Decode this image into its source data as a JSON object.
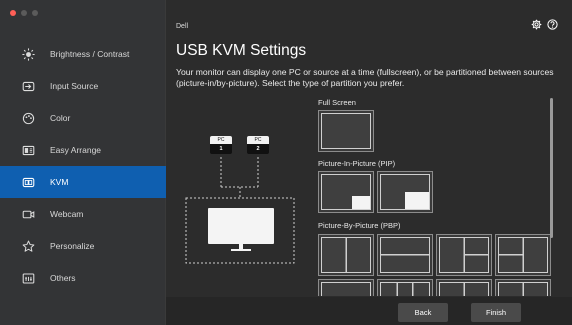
{
  "app": {
    "brand": "Dell"
  },
  "sidebar": {
    "items": [
      {
        "label": "Brightness / Contrast",
        "icon": "brightness-icon",
        "active": false
      },
      {
        "label": "Input Source",
        "icon": "input-source-icon",
        "active": false
      },
      {
        "label": "Color",
        "icon": "color-icon",
        "active": false
      },
      {
        "label": "Easy Arrange",
        "icon": "easy-arrange-icon",
        "active": false
      },
      {
        "label": "KVM",
        "icon": "kvm-icon",
        "active": true
      },
      {
        "label": "Webcam",
        "icon": "webcam-icon",
        "active": false
      },
      {
        "label": "Personalize",
        "icon": "star-icon",
        "active": false
      },
      {
        "label": "Others",
        "icon": "others-icon",
        "active": false
      }
    ]
  },
  "header": {
    "title": "USB KVM Settings",
    "description": "Your monitor can display one PC or source at a time (fullscreen), or be partitioned between sources (picture-in/by-picture). Select the type of partition you prefer."
  },
  "diagram": {
    "pcs": [
      {
        "top": "PC",
        "num": "1"
      },
      {
        "top": "PC",
        "num": "2"
      }
    ]
  },
  "gallery": {
    "sections": {
      "full": "Full Screen",
      "pip": "Picture-In-Picture (PIP)",
      "pbp": "Picture-By-Picture (PBP)"
    }
  },
  "footer": {
    "back": "Back",
    "finish": "Finish"
  },
  "colors": {
    "accent": "#0f5fb0",
    "sidebar_bg": "#333436",
    "main_bg": "#2c2c2c"
  }
}
